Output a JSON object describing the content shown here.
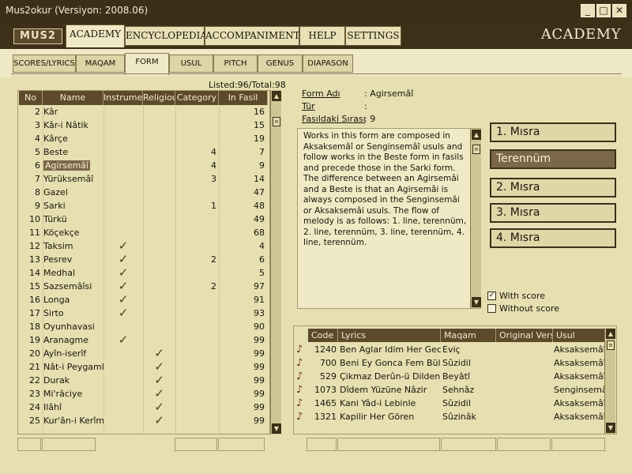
{
  "window": {
    "title": "Mus2okur  (Versiyon: 2008.06)"
  },
  "logo": "MUS2",
  "main_tabs": [
    {
      "label": "ACADEMY",
      "active": true
    },
    {
      "label": "ENCYCLOPEDIA"
    },
    {
      "label": "ACCOMPANIMENT"
    },
    {
      "label": "HELP"
    },
    {
      "label": "SETTINGS"
    }
  ],
  "section_title": "ACADEMY",
  "sub_tabs": [
    {
      "label": "SCORES/LYRICS"
    },
    {
      "label": "MAQAM"
    },
    {
      "label": "FORM",
      "active": true
    },
    {
      "label": "USUL"
    },
    {
      "label": "PITCH"
    },
    {
      "label": "GENUS"
    },
    {
      "label": "DIAPASON"
    }
  ],
  "listed": "Listed:96/Total:98",
  "form_table": {
    "columns": [
      "No",
      "Name",
      "Instrumental",
      "Religious",
      "Category",
      "In Fasil"
    ],
    "rows": [
      {
        "no": "2",
        "name": "Kâr",
        "instr": "",
        "relig": "",
        "cat": "",
        "fasil": "16"
      },
      {
        "no": "3",
        "name": "Kâr-i Nâtik",
        "instr": "",
        "relig": "",
        "cat": "",
        "fasil": "15"
      },
      {
        "no": "4",
        "name": "Kârçe",
        "instr": "",
        "relig": "",
        "cat": "",
        "fasil": "19"
      },
      {
        "no": "5",
        "name": "Beste",
        "instr": "",
        "relig": "",
        "cat": "4",
        "fasil": "7"
      },
      {
        "no": "6",
        "name": "Agirsemâî",
        "instr": "",
        "relig": "",
        "cat": "4",
        "fasil": "9",
        "selected": true
      },
      {
        "no": "7",
        "name": "Yürüksemâî",
        "instr": "",
        "relig": "",
        "cat": "3",
        "fasil": "14"
      },
      {
        "no": "8",
        "name": "Gazel",
        "instr": "",
        "relig": "",
        "cat": "",
        "fasil": "47"
      },
      {
        "no": "9",
        "name": "Sarki",
        "instr": "",
        "relig": "",
        "cat": "1",
        "fasil": "48"
      },
      {
        "no": "10",
        "name": "Türkü",
        "instr": "",
        "relig": "",
        "cat": "",
        "fasil": "49"
      },
      {
        "no": "11",
        "name": "Köçekçe",
        "instr": "",
        "relig": "",
        "cat": "",
        "fasil": "68"
      },
      {
        "no": "12",
        "name": "Taksim",
        "instr": "✓",
        "relig": "",
        "cat": "",
        "fasil": "4"
      },
      {
        "no": "13",
        "name": "Pesrev",
        "instr": "✓",
        "relig": "",
        "cat": "2",
        "fasil": "6"
      },
      {
        "no": "14",
        "name": "Medhal",
        "instr": "✓",
        "relig": "",
        "cat": "",
        "fasil": "5"
      },
      {
        "no": "15",
        "name": "Sazsemâîsi",
        "instr": "✓",
        "relig": "",
        "cat": "2",
        "fasil": "97"
      },
      {
        "no": "16",
        "name": "Longa",
        "instr": "✓",
        "relig": "",
        "cat": "",
        "fasil": "91"
      },
      {
        "no": "17",
        "name": "Sirto",
        "instr": "✓",
        "relig": "",
        "cat": "",
        "fasil": "93"
      },
      {
        "no": "18",
        "name": "Oyunhavasi",
        "instr": "",
        "relig": "",
        "cat": "",
        "fasil": "90"
      },
      {
        "no": "19",
        "name": "Aranagme",
        "instr": "✓",
        "relig": "",
        "cat": "",
        "fasil": "99"
      },
      {
        "no": "20",
        "name": "Ayîn-iserîf",
        "instr": "",
        "relig": "✓",
        "cat": "",
        "fasil": "99"
      },
      {
        "no": "21",
        "name": "Nât-i Peygaml",
        "instr": "",
        "relig": "✓",
        "cat": "",
        "fasil": "99"
      },
      {
        "no": "22",
        "name": "Durak",
        "instr": "",
        "relig": "✓",
        "cat": "",
        "fasil": "99"
      },
      {
        "no": "23",
        "name": "Mi'râciye",
        "instr": "",
        "relig": "✓",
        "cat": "",
        "fasil": "99"
      },
      {
        "no": "24",
        "name": "Ilâhî",
        "instr": "",
        "relig": "✓",
        "cat": "",
        "fasil": "99"
      },
      {
        "no": "25",
        "name": "Kur'ân-i Kerîm",
        "instr": "",
        "relig": "✓",
        "cat": "",
        "fasil": "99"
      }
    ]
  },
  "form_info": {
    "form_adi_label": "Form Adı",
    "form_adi_value": ": Agirsemâî",
    "tur_label": "Tür",
    "tur_value": ":",
    "fasil_label": "Fasıldaki Sırası",
    "fasil_value": ": 9"
  },
  "description": "  Works in this form are composed in Aksaksemâî or Senginsemâî usuls and follow works in the Beste form in fasils and precede those in the Sarki form. The difference between an Agirsemâi and a Beste is that an Agirsemâi is always composed in the Senginsemâi or Aksaksemâi usuls. The flow of melody is as follows: 1. line, terennüm, 2. line, terennüm, 3. line, terennüm, 4. line, terennüm.",
  "misra_buttons": [
    {
      "label": "1. Mısra"
    },
    {
      "label": "Terennüm",
      "active": true
    },
    {
      "label": "2. Mısra"
    },
    {
      "label": "3. Mısra"
    },
    {
      "label": "4. Mısra"
    }
  ],
  "score_options": {
    "with_score": "With score",
    "with_checked": true,
    "without_score": "Without score",
    "without_checked": false
  },
  "songs_table": {
    "columns": [
      "Code",
      "Lyrics",
      "Maqam",
      "Original Version",
      "Usul"
    ],
    "rows": [
      {
        "code": "1240",
        "lyrics": "Ben Aglar Idim Her Gece",
        "maqam": "Eviç",
        "orig": "",
        "usul": "Aksaksemâî"
      },
      {
        "code": "700",
        "lyrics": "Beni Ey Gonca Fem Bülbül",
        "maqam": "Sûzidil",
        "orig": "",
        "usul": "Aksaksemâî"
      },
      {
        "code": "529",
        "lyrics": "Çikmaz Derûn-ü Dilden",
        "maqam": "Beyâtî",
        "orig": "",
        "usul": "Aksaksemâî"
      },
      {
        "code": "1073",
        "lyrics": "Dîdem Yüzüne Nâzir",
        "maqam": "Sehnâz",
        "orig": "",
        "usul": "Senginsemâî"
      },
      {
        "code": "1465",
        "lyrics": "Kani Yâd-i Lebinle",
        "maqam": "Sûzidil",
        "orig": "",
        "usul": "Aksaksemâî"
      },
      {
        "code": "1321",
        "lyrics": "Kapilir Her Gören",
        "maqam": "Sûzinâk",
        "orig": "",
        "usul": "Aksaksemâî"
      }
    ]
  },
  "colors": {
    "frame": "#3e3018",
    "panel": "#e6dfb2",
    "header": "#5c4a2b",
    "selection": "#7a6848"
  }
}
